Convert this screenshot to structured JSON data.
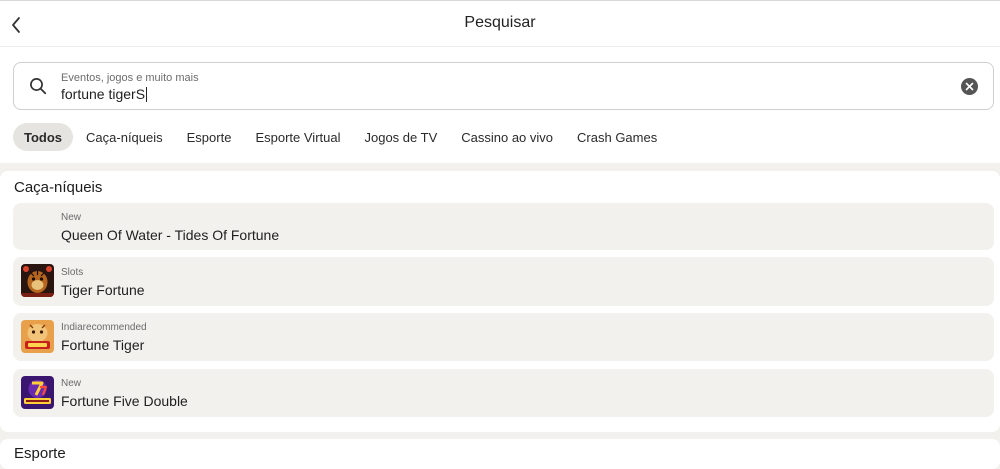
{
  "header": {
    "title": "Pesquisar",
    "back_icon": "chevron-left-icon"
  },
  "search": {
    "placeholder": "Eventos, jogos e muito mais",
    "value": "fortune tigerS",
    "search_icon": "search-icon",
    "clear_icon": "clear-circle-x-icon"
  },
  "tabs": [
    {
      "label": "Todos",
      "active": true
    },
    {
      "label": "Caça-níqueis",
      "active": false
    },
    {
      "label": "Esporte",
      "active": false
    },
    {
      "label": "Esporte Virtual",
      "active": false
    },
    {
      "label": "Jogos de TV",
      "active": false
    },
    {
      "label": "Cassino ao vivo",
      "active": false
    },
    {
      "label": "Crash Games",
      "active": false
    }
  ],
  "sections": {
    "slots": {
      "title": "Caça-níqueis",
      "items": [
        {
          "category": "New",
          "name": "Queen Of Water - Tides Of Fortune",
          "thumbnail": "none"
        },
        {
          "category": "Slots",
          "name": "Tiger Fortune",
          "thumbnail": "tiger-fortune-thumbnail"
        },
        {
          "category": "Indiarecommended",
          "name": "Fortune Tiger",
          "thumbnail": "fortune-tiger-thumbnail"
        },
        {
          "category": "New",
          "name": "Fortune Five Double",
          "thumbnail": "fortune-five-double-thumbnail"
        }
      ]
    },
    "sports": {
      "title": "Esporte"
    }
  },
  "colors": {
    "page_background": "#f2f1ee",
    "card_background": "#ffffff",
    "active_tab_background": "#e5e4e0",
    "item_background": "#f2f1ee"
  }
}
